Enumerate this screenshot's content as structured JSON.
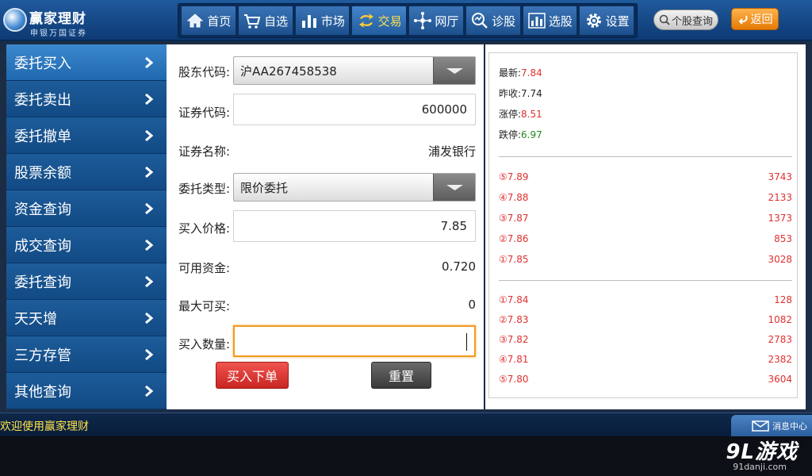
{
  "header": {
    "logo_title": "赢家理财",
    "logo_subtitle": "申银万国证券",
    "nav": [
      {
        "label": "首页",
        "icon": "home-icon"
      },
      {
        "label": "自选",
        "icon": "cart-icon"
      },
      {
        "label": "市场",
        "icon": "bar-chart-icon"
      },
      {
        "label": "交易",
        "icon": "exchange-icon",
        "active": true
      },
      {
        "label": "网厅",
        "icon": "network-icon"
      },
      {
        "label": "诊股",
        "icon": "diagnose-icon"
      },
      {
        "label": "选股",
        "icon": "stock-pick-icon"
      },
      {
        "label": "设置",
        "icon": "gear-icon"
      }
    ],
    "search_label": "个股查询",
    "back_label": "返回"
  },
  "sidebar": {
    "items": [
      {
        "label": "委托买入",
        "active": true
      },
      {
        "label": "委托卖出"
      },
      {
        "label": "委托撤单"
      },
      {
        "label": "股票余额"
      },
      {
        "label": "资金查询"
      },
      {
        "label": "成交查询"
      },
      {
        "label": "委托查询"
      },
      {
        "label": "天天增"
      },
      {
        "label": "三方存管"
      },
      {
        "label": "其他查询"
      }
    ]
  },
  "form": {
    "holder_code_label": "股东代码:",
    "holder_code_value": "沪AA267458538",
    "security_code_label": "证券代码:",
    "security_code_value": "600000",
    "security_name_label": "证券名称:",
    "security_name_value": "浦发银行",
    "order_type_label": "委托类型:",
    "order_type_value": "限价委托",
    "buy_price_label": "买入价格:",
    "buy_price_value": "7.85",
    "available_funds_label": "可用资金:",
    "available_funds_value": "0.720",
    "max_buy_label": "最大可买:",
    "max_buy_value": "0",
    "buy_quantity_label": "买入数量:",
    "buy_quantity_value": "",
    "submit_label": "买入下单",
    "reset_label": "重置"
  },
  "quote": {
    "latest_label": "最新:",
    "latest_value": "7.84",
    "prev_close_label": "昨收:",
    "prev_close_value": "7.74",
    "limit_up_label": "涨停:",
    "limit_up_value": "8.51",
    "limit_down_label": "跌停:",
    "limit_down_value": "6.97",
    "asks": [
      {
        "level": "⑤",
        "price": "7.89",
        "volume": "3743"
      },
      {
        "level": "④",
        "price": "7.88",
        "volume": "2133"
      },
      {
        "level": "③",
        "price": "7.87",
        "volume": "1373"
      },
      {
        "level": "②",
        "price": "7.86",
        "volume": "853"
      },
      {
        "level": "①",
        "price": "7.85",
        "volume": "3028"
      }
    ],
    "bids": [
      {
        "level": "①",
        "price": "7.84",
        "volume": "128"
      },
      {
        "level": "②",
        "price": "7.83",
        "volume": "1082"
      },
      {
        "level": "③",
        "price": "7.82",
        "volume": "2783"
      },
      {
        "level": "④",
        "price": "7.81",
        "volume": "2382"
      },
      {
        "level": "⑤",
        "price": "7.80",
        "volume": "3604"
      }
    ]
  },
  "footer": {
    "welcome": "欢迎使用赢家理财",
    "message_center": "消息中心"
  },
  "watermark": {
    "main": "9L游戏",
    "sub": "91danji.com"
  },
  "colors": {
    "header_bg": "#1f5a9c",
    "active_nav_text": "#ffe14d",
    "price_up": "#e03030",
    "price_down": "#1d8a1d",
    "focus_border": "#f39a1e"
  }
}
